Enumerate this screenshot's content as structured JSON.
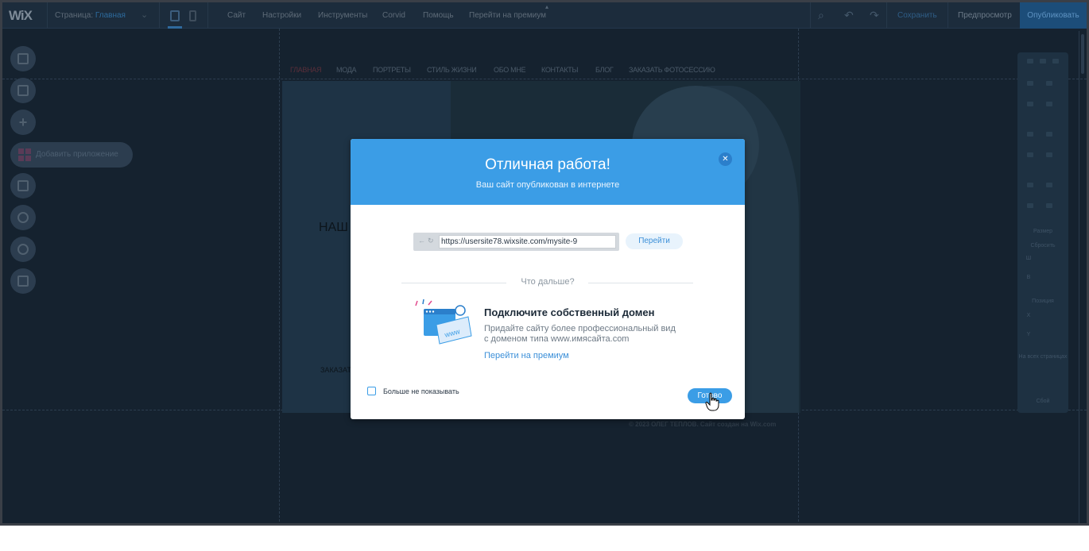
{
  "topbar": {
    "logo": "WiX",
    "page_label": "Страница:",
    "page_name": "Главная",
    "menu": [
      "Сайт",
      "Настройки",
      "Инструменты",
      "Corvid",
      "Помощь",
      "Перейти на премиум"
    ],
    "save_label": "Сохранить",
    "preview_label": "Предпросмотр",
    "publish_label": "Опубликовать",
    "icons": [
      "search-icon",
      "undo-icon",
      "redo-icon"
    ]
  },
  "left_toolbar": {
    "items": [
      "menus-pages-icon",
      "background-icon",
      "add-icon",
      "add-apps-icon",
      "media-icon",
      "blog-icon",
      "chat-icon",
      "events-icon"
    ],
    "add_apps_label": "Добавить приложение"
  },
  "site": {
    "nav": [
      "ГЛАВНАЯ",
      "МОДА",
      "ПОРТРЕТЫ",
      "СТИЛЬ ЖИЗНИ",
      "ОБО МНЕ",
      "КОНТАКТЫ",
      "БЛОГ",
      "ЗАКАЗАТЬ ФОТОСЕССИЮ"
    ],
    "hero_title": "НАШ",
    "hero_button": "ЗАКАЗАТ",
    "footer": "© 2023 ОЛЕГ ТЕПЛОВ. Сайт создан на Wix.com"
  },
  "inspector": {
    "size_label": "Размер",
    "size_button": "Сбросить",
    "width_label": "Ш",
    "height_label": "В",
    "position_label": "Позиция",
    "x_label": "X",
    "y_label": "Y",
    "show_on_all_label": "На всех страницах",
    "help_label": "Сбой"
  },
  "modal": {
    "title": "Отличная работа!",
    "subtitle": "Ваш сайт опубликован в интернете",
    "close_icon": "close-icon",
    "url": "https://usersite78.wixsite.com/mysite-9",
    "go_label": "Перейти",
    "whats_next": "Что дальше?",
    "domain_title": "Подключите собственный домен",
    "domain_desc_line1": "Придайте сайту более профессиональный вид",
    "domain_desc_line2": "с доменом типа www.имясайта.com",
    "domain_link": "Перейти на премиум",
    "illustration_text": "www",
    "dont_show_label": "Больше не показывать",
    "dont_show_checked": false,
    "done_label": "Готово"
  },
  "colors": {
    "accent": "#3b9de6",
    "editor_bg": "#15222f",
    "topbar_bg": "#1c2c3c"
  }
}
